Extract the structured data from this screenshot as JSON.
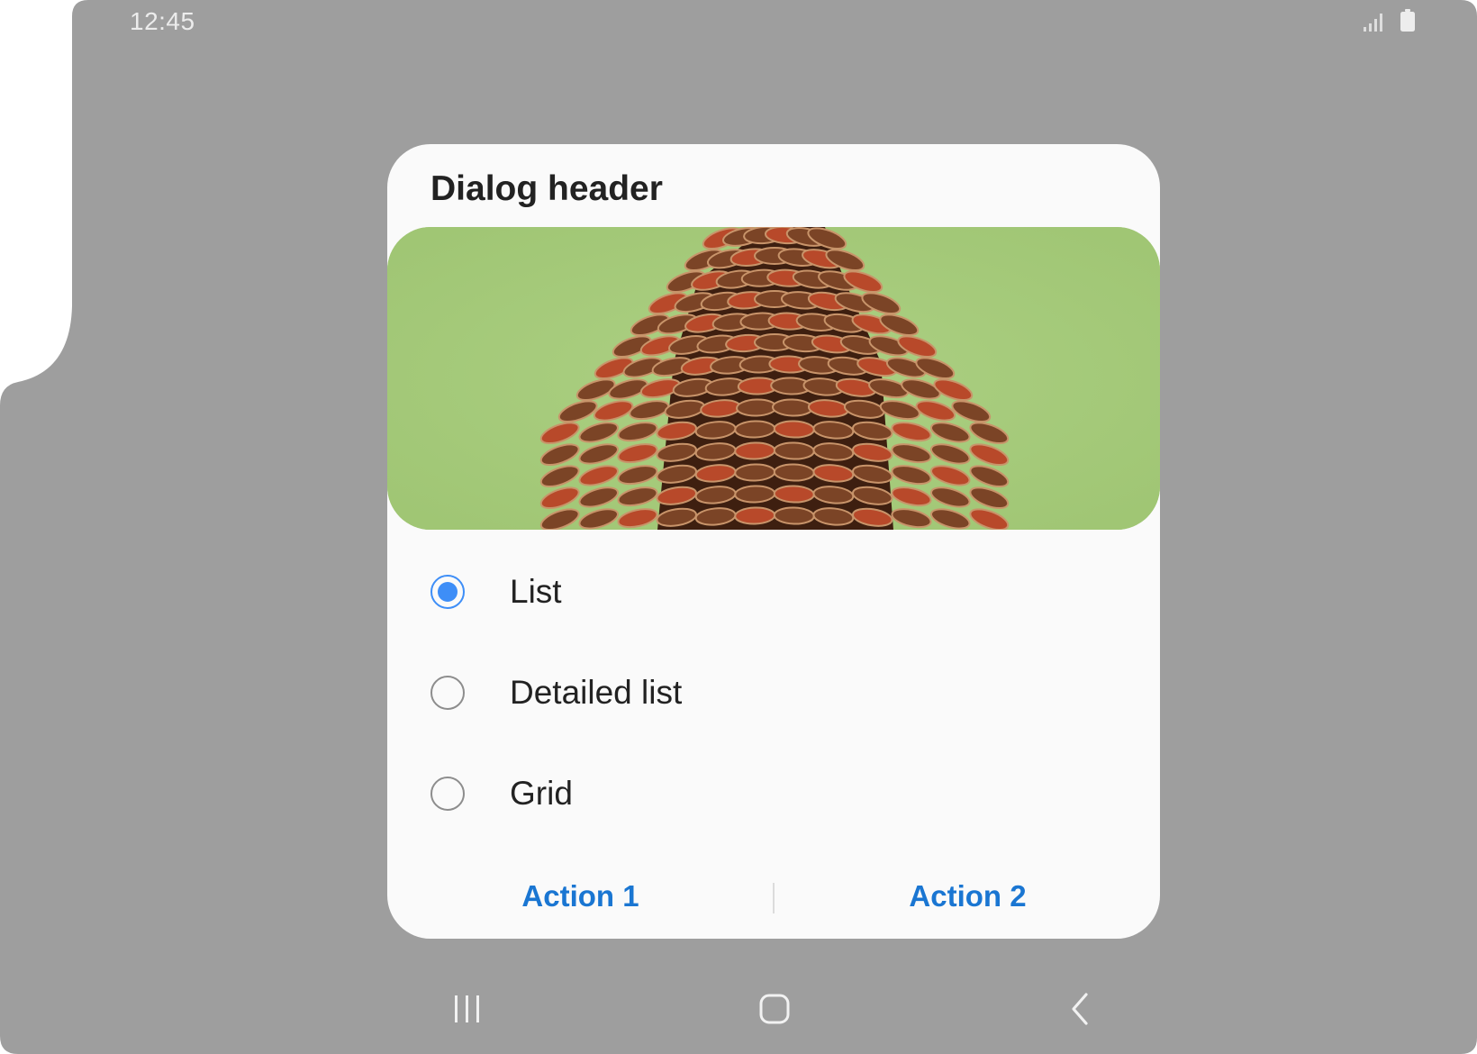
{
  "status_bar": {
    "time": "12:45",
    "icons": [
      "signal-icon",
      "battery-icon"
    ]
  },
  "dialog": {
    "title": "Dialog header",
    "image": {
      "subject": "pine-cone-image",
      "background_color": "#a6cb7b"
    },
    "options": [
      {
        "label": "List",
        "selected": true
      },
      {
        "label": "Detailed list",
        "selected": false
      },
      {
        "label": "Grid",
        "selected": false
      }
    ],
    "actions": [
      {
        "label": "Action 1"
      },
      {
        "label": "Action 2"
      }
    ]
  },
  "navigation_bar": {
    "buttons": [
      "recents-icon",
      "home-icon",
      "back-icon"
    ]
  },
  "colors": {
    "scrim": "#9e9e9e",
    "accent": "#3e8ef7",
    "action_text": "#1a76d2",
    "dialog_bg": "#fafafa"
  }
}
